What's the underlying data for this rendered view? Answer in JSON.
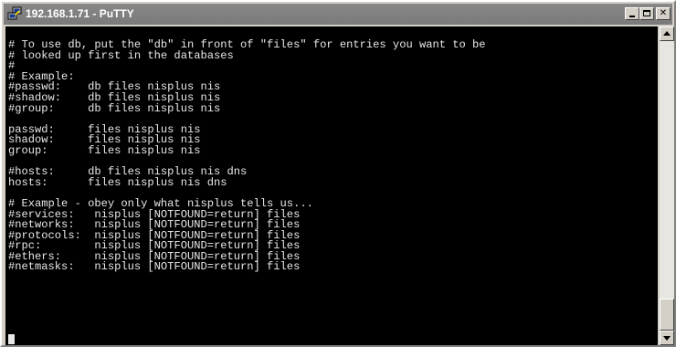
{
  "window": {
    "title": "192.168.1.71 - PuTTY",
    "icon": "putty-computer-icon"
  },
  "titlebar_buttons": {
    "minimize": "minimize-icon",
    "maximize": "maximize-icon",
    "close_label": "✕"
  },
  "terminal": {
    "lines": [
      "# To use db, put the \"db\" in front of \"files\" for entries you want to be",
      "# looked up first in the databases",
      "#",
      "# Example:",
      "#passwd:    db files nisplus nis",
      "#shadow:    db files nisplus nis",
      "#group:     db files nisplus nis",
      "",
      "passwd:     files nisplus nis",
      "shadow:     files nisplus nis",
      "group:      files nisplus nis",
      "",
      "#hosts:     db files nisplus nis dns",
      "hosts:      files nisplus nis dns",
      "",
      "# Example - obey only what nisplus tells us...",
      "#services:   nisplus [NOTFOUND=return] files",
      "#networks:   nisplus [NOTFOUND=return] files",
      "#protocols:  nisplus [NOTFOUND=return] files",
      "#rpc:        nisplus [NOTFOUND=return] files",
      "#ethers:     nisplus [NOTFOUND=return] files",
      "#netmasks:   nisplus [NOTFOUND=return] files"
    ],
    "text_color": "#e8e8e8",
    "background": "#000000"
  },
  "scrollbar": {
    "up_icon": "scroll-up-arrow-icon",
    "down_icon": "scroll-down-arrow-icon",
    "position": "bottom"
  }
}
